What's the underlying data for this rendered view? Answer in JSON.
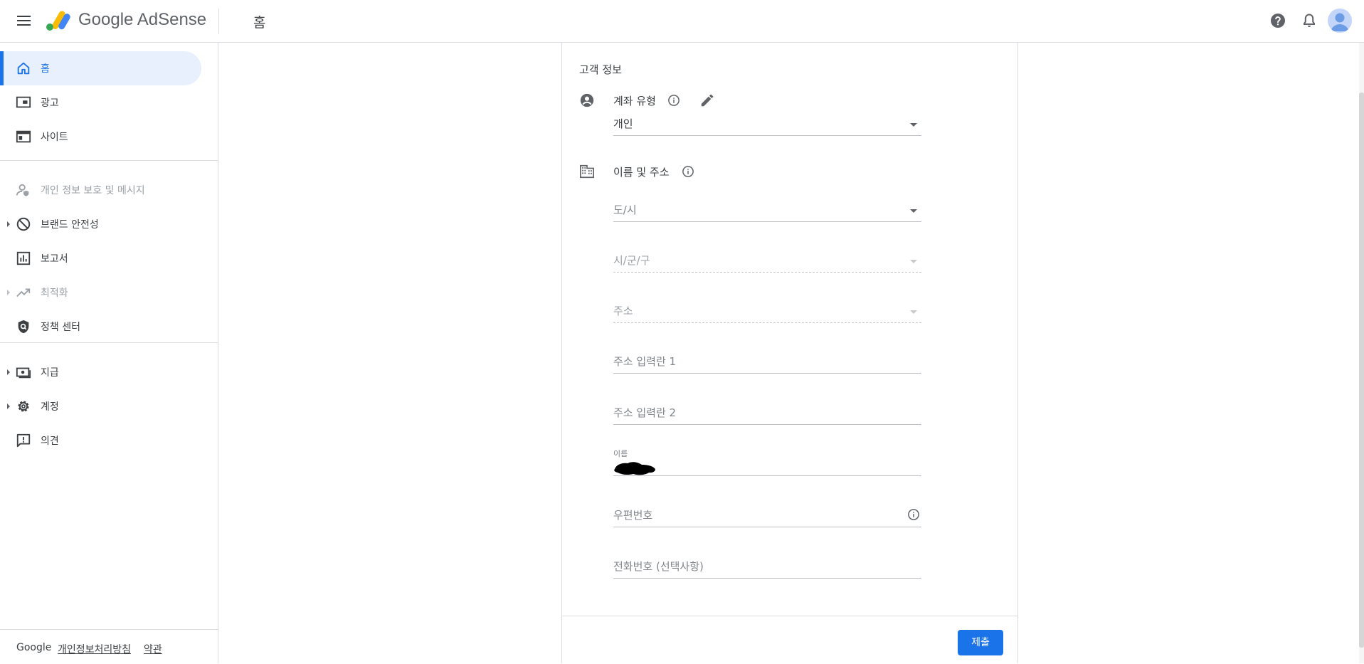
{
  "header": {
    "app_name": "Google AdSense",
    "page_title": "홈",
    "icons": [
      "menu-icon",
      "adsense-logo-icon",
      "help-icon",
      "notifications-icon",
      "avatar"
    ]
  },
  "sidebar": {
    "items": [
      {
        "label": "홈",
        "icon": "home-icon",
        "active": true
      },
      {
        "label": "광고",
        "icon": "ads-icon"
      },
      {
        "label": "사이트",
        "icon": "sites-icon"
      },
      {
        "label": "개인 정보 보호 및 메시지",
        "icon": "privacy-icon",
        "disabled": true
      },
      {
        "label": "브랜드 안전성",
        "icon": "block-icon",
        "expandable": true
      },
      {
        "label": "보고서",
        "icon": "reports-icon"
      },
      {
        "label": "최적화",
        "icon": "trending-icon",
        "disabled": true,
        "expandable": true
      },
      {
        "label": "정책 센터",
        "icon": "policy-icon"
      },
      {
        "label": "지급",
        "icon": "payments-icon",
        "expandable": true
      },
      {
        "label": "계정",
        "icon": "gear-icon",
        "expandable": true
      },
      {
        "label": "의견",
        "icon": "feedback-icon"
      }
    ],
    "footer": {
      "brand": "Google",
      "privacy_link": "개인정보처리방침",
      "terms_link": "약관"
    }
  },
  "form": {
    "title": "고객 정보",
    "account_type": {
      "label": "계좌 유형",
      "value": "개인"
    },
    "name_address": {
      "label": "이름 및 주소",
      "fields": {
        "province": "도/시",
        "city": "시/군/구",
        "address": "주소",
        "address_line1": "주소 입력란 1",
        "address_line2": "주소 입력란 2",
        "name_label": "이름",
        "postal_code": "우편번호",
        "phone": "전화번호 (선택사항)"
      }
    },
    "submit_label": "제출"
  },
  "colors": {
    "accent": "#1a73e8",
    "active_bg": "#e8f0fe",
    "divider": "#dadce0",
    "text": "#3c4043",
    "muted": "#80868b"
  }
}
